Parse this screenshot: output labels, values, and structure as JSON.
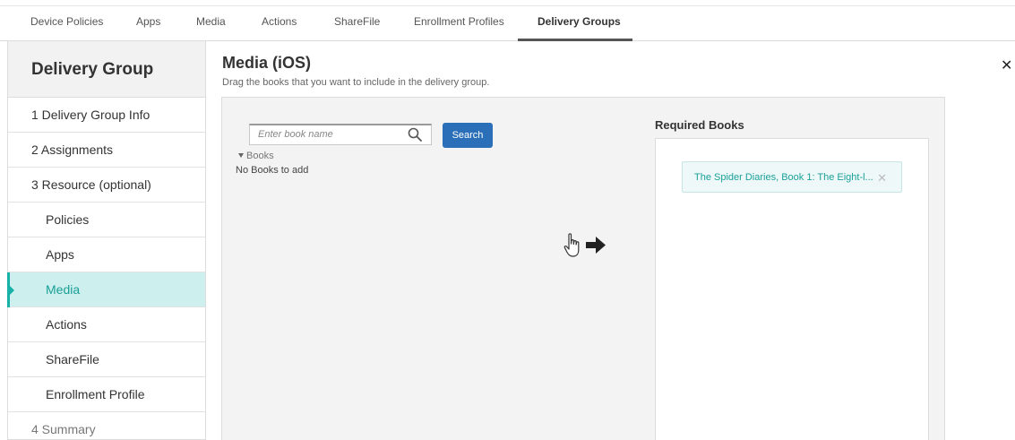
{
  "top_tabs": [
    {
      "label": "Device Policies"
    },
    {
      "label": "Apps"
    },
    {
      "label": "Media"
    },
    {
      "label": "Actions"
    },
    {
      "label": "ShareFile"
    },
    {
      "label": "Enrollment Profiles"
    },
    {
      "label": "Delivery Groups",
      "active": true
    }
  ],
  "sidebar": {
    "title": "Delivery Group",
    "items": [
      {
        "label": "1 Delivery Group Info"
      },
      {
        "label": "2 Assignments"
      },
      {
        "label": "3 Resource (optional)"
      },
      {
        "label": "Policies"
      },
      {
        "label": "Apps"
      },
      {
        "label": "Media",
        "active": true
      },
      {
        "label": "Actions"
      },
      {
        "label": "ShareFile"
      },
      {
        "label": "Enrollment Profile"
      },
      {
        "label": "4 Summary"
      }
    ]
  },
  "header": {
    "title": "Media (iOS)",
    "subtitle": "Drag the books that you want to include in the delivery group.",
    "close_icon": "close-icon"
  },
  "search": {
    "placeholder": "Enter book name",
    "value": "",
    "button_label": "Search",
    "icon": "search-icon"
  },
  "books": {
    "toggle_label": "Books",
    "empty_text": "No Books to add"
  },
  "drag_hint": {
    "icons": [
      "hand-pointer-icon",
      "arrow-right-icon"
    ]
  },
  "required_books": {
    "title": "Required Books",
    "items": [
      {
        "label": "The Spider Diaries, Book 1: The Eight-l..."
      }
    ]
  },
  "colors": {
    "accent": "#18b1a8",
    "active_bg": "#cdf0ee",
    "button": "#2a6fb8"
  }
}
